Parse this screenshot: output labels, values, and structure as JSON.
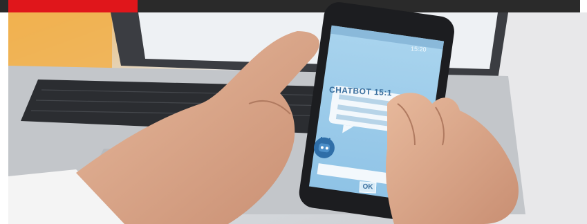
{
  "banner": {
    "accent_color": "#e0161b",
    "bar_color": "#2a2a2a"
  },
  "phone": {
    "status_time": "15:20",
    "chat_header": "CHATBOT 15:1",
    "ok_label": "OK",
    "bot_icon": "robot-icon"
  }
}
